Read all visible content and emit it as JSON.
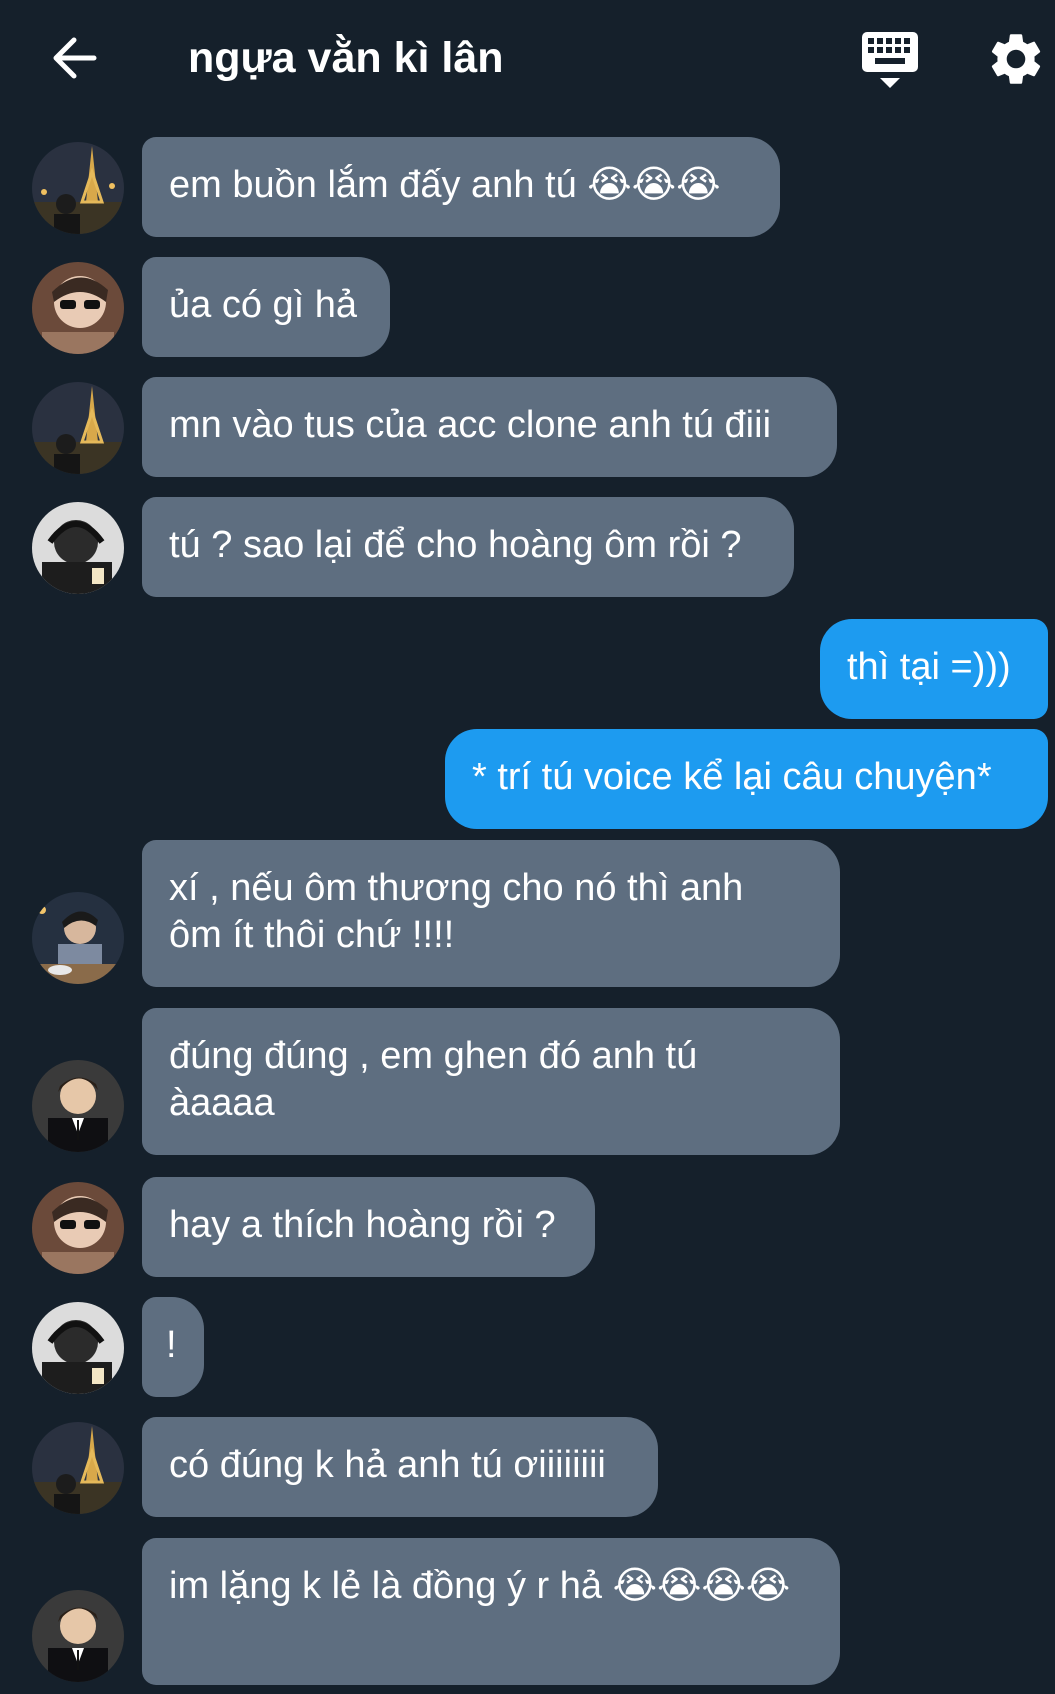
{
  "header": {
    "title": "ngựa vằn kì lân",
    "back_icon": "arrow-left-icon",
    "keyboard_icon": "keyboard-icon",
    "settings_icon": "gear-icon"
  },
  "colors": {
    "background": "#15202b",
    "incoming_bubble": "#5e6e80",
    "outgoing_bubble": "#1d9bf0",
    "text": "#ffffff"
  },
  "messages": [
    {
      "sender": "incoming",
      "avatar": "eiffel-tower-photo",
      "text": "em buồn lắm đấy anh tú ",
      "emoji": "😭😭😭"
    },
    {
      "sender": "incoming",
      "avatar": "sunglasses-portrait",
      "text": "ủa có gì hả"
    },
    {
      "sender": "incoming",
      "avatar": "eiffel-tower-photo",
      "text": "mn vào tus của acc clone anh tú điii"
    },
    {
      "sender": "incoming",
      "avatar": "headphones-portrait",
      "text": "tú ? sao lại để cho hoàng ôm rồi ?"
    },
    {
      "sender": "outgoing",
      "text": "thì tại =)))"
    },
    {
      "sender": "outgoing",
      "text": "* trí tú voice kể lại câu chuyện*"
    },
    {
      "sender": "incoming",
      "avatar": "dinner-table-photo",
      "text": "xí , nếu ôm thương cho nó thì anh\nôm ít thôi chứ !!!!"
    },
    {
      "sender": "incoming",
      "avatar": "suit-portrait",
      "text": "đúng đúng , em ghen đó anh tú\nàaaaa"
    },
    {
      "sender": "incoming",
      "avatar": "sunglasses-portrait",
      "text": "hay a thích hoàng rồi ?"
    },
    {
      "sender": "incoming",
      "avatar": "headphones-portrait",
      "text": "!"
    },
    {
      "sender": "incoming",
      "avatar": "eiffel-tower-photo",
      "text": "có đúng k hả anh tú ơiiiiiiii"
    },
    {
      "sender": "incoming",
      "avatar": "suit-portrait",
      "text": "im lặng k lẻ là đồng ý r hả ",
      "emoji": "😭😭😭😭"
    }
  ]
}
